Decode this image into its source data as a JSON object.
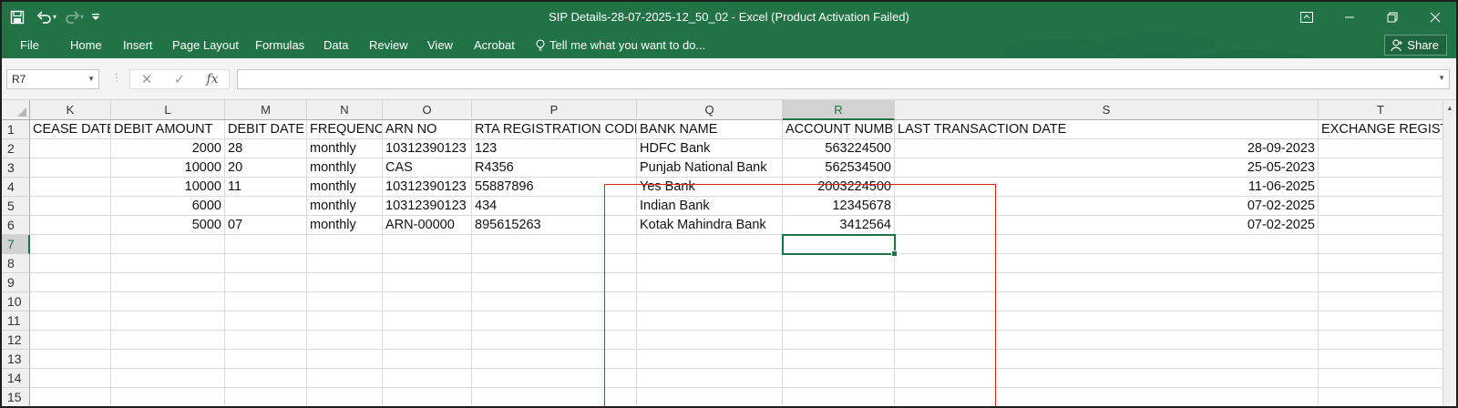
{
  "app": {
    "title": "SIP Details-28-07-2025-12_50_02 - Excel (Product Activation Failed)",
    "accent_color": "#217346"
  },
  "quick_access": {
    "save_icon": "save-icon",
    "undo_icon": "undo-icon",
    "redo_icon": "redo-icon",
    "customize_icon": "customize-qat-icon"
  },
  "window_controls": [
    "ribbon-display-options-icon",
    "minimize-icon",
    "restore-icon",
    "close-icon"
  ],
  "ribbon": {
    "tabs": [
      "File",
      "Home",
      "Insert",
      "Page Layout",
      "Formulas",
      "Data",
      "Review",
      "View",
      "Acrobat"
    ],
    "tell_me": "Tell me what you want to do...",
    "share_label": "Share"
  },
  "formula_bar": {
    "name_box": "R7",
    "formula": ""
  },
  "sheet": {
    "columns": [
      "K",
      "L",
      "M",
      "N",
      "O",
      "P",
      "Q",
      "R",
      "S",
      "T"
    ],
    "selected_column": "R",
    "rows": [
      "1",
      "2",
      "3",
      "4",
      "5",
      "6",
      "7",
      "8",
      "9",
      "10",
      "11",
      "12",
      "13",
      "14",
      "15"
    ],
    "selected_row": "7",
    "headers": [
      "CEASE DATE",
      "DEBIT  AMOUNT",
      "DEBIT DATE",
      "FREQUENCY",
      "ARN NO",
      "RTA REGISTRATION CODE",
      "BANK NAME",
      "ACCOUNT NUMBER",
      "LAST TRANSACTION DATE",
      "EXCHANGE REGISTRATION"
    ],
    "data": [
      [
        "",
        "2000",
        "28",
        "monthly",
        "10312390123",
        "123",
        "HDFC Bank",
        "563224500",
        "28-09-2023",
        ""
      ],
      [
        "",
        "10000",
        "20",
        "monthly",
        "CAS",
        "R4356",
        "Punjab National Bank",
        "562534500",
        "25-05-2023",
        ""
      ],
      [
        "",
        "10000",
        "11",
        "monthly",
        "10312390123",
        "55887896",
        "Yes Bank",
        "2003224500",
        "11-06-2025",
        ""
      ],
      [
        "",
        "6000",
        "",
        "monthly",
        "10312390123",
        "434",
        "Indian Bank",
        "12345678",
        "07-02-2025",
        ""
      ],
      [
        "",
        "5000",
        "07",
        "monthly",
        "ARN-00000",
        "895615263",
        "Kotak Mahindra Bank",
        "3412564",
        "07-02-2025",
        ""
      ]
    ],
    "annotation_color": "#e02020"
  }
}
